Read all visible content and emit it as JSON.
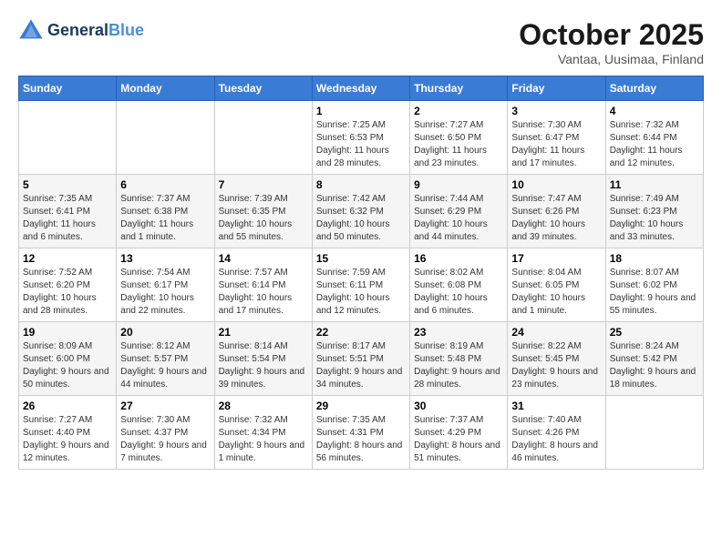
{
  "header": {
    "logo_line1": "General",
    "logo_line2": "Blue",
    "month": "October 2025",
    "location": "Vantaa, Uusimaa, Finland"
  },
  "weekdays": [
    "Sunday",
    "Monday",
    "Tuesday",
    "Wednesday",
    "Thursday",
    "Friday",
    "Saturday"
  ],
  "weeks": [
    [
      {
        "day": "",
        "info": ""
      },
      {
        "day": "",
        "info": ""
      },
      {
        "day": "",
        "info": ""
      },
      {
        "day": "1",
        "info": "Sunrise: 7:25 AM\nSunset: 6:53 PM\nDaylight: 11 hours and 28 minutes."
      },
      {
        "day": "2",
        "info": "Sunrise: 7:27 AM\nSunset: 6:50 PM\nDaylight: 11 hours and 23 minutes."
      },
      {
        "day": "3",
        "info": "Sunrise: 7:30 AM\nSunset: 6:47 PM\nDaylight: 11 hours and 17 minutes."
      },
      {
        "day": "4",
        "info": "Sunrise: 7:32 AM\nSunset: 6:44 PM\nDaylight: 11 hours and 12 minutes."
      }
    ],
    [
      {
        "day": "5",
        "info": "Sunrise: 7:35 AM\nSunset: 6:41 PM\nDaylight: 11 hours and 6 minutes."
      },
      {
        "day": "6",
        "info": "Sunrise: 7:37 AM\nSunset: 6:38 PM\nDaylight: 11 hours and 1 minute."
      },
      {
        "day": "7",
        "info": "Sunrise: 7:39 AM\nSunset: 6:35 PM\nDaylight: 10 hours and 55 minutes."
      },
      {
        "day": "8",
        "info": "Sunrise: 7:42 AM\nSunset: 6:32 PM\nDaylight: 10 hours and 50 minutes."
      },
      {
        "day": "9",
        "info": "Sunrise: 7:44 AM\nSunset: 6:29 PM\nDaylight: 10 hours and 44 minutes."
      },
      {
        "day": "10",
        "info": "Sunrise: 7:47 AM\nSunset: 6:26 PM\nDaylight: 10 hours and 39 minutes."
      },
      {
        "day": "11",
        "info": "Sunrise: 7:49 AM\nSunset: 6:23 PM\nDaylight: 10 hours and 33 minutes."
      }
    ],
    [
      {
        "day": "12",
        "info": "Sunrise: 7:52 AM\nSunset: 6:20 PM\nDaylight: 10 hours and 28 minutes."
      },
      {
        "day": "13",
        "info": "Sunrise: 7:54 AM\nSunset: 6:17 PM\nDaylight: 10 hours and 22 minutes."
      },
      {
        "day": "14",
        "info": "Sunrise: 7:57 AM\nSunset: 6:14 PM\nDaylight: 10 hours and 17 minutes."
      },
      {
        "day": "15",
        "info": "Sunrise: 7:59 AM\nSunset: 6:11 PM\nDaylight: 10 hours and 12 minutes."
      },
      {
        "day": "16",
        "info": "Sunrise: 8:02 AM\nSunset: 6:08 PM\nDaylight: 10 hours and 6 minutes."
      },
      {
        "day": "17",
        "info": "Sunrise: 8:04 AM\nSunset: 6:05 PM\nDaylight: 10 hours and 1 minute."
      },
      {
        "day": "18",
        "info": "Sunrise: 8:07 AM\nSunset: 6:02 PM\nDaylight: 9 hours and 55 minutes."
      }
    ],
    [
      {
        "day": "19",
        "info": "Sunrise: 8:09 AM\nSunset: 6:00 PM\nDaylight: 9 hours and 50 minutes."
      },
      {
        "day": "20",
        "info": "Sunrise: 8:12 AM\nSunset: 5:57 PM\nDaylight: 9 hours and 44 minutes."
      },
      {
        "day": "21",
        "info": "Sunrise: 8:14 AM\nSunset: 5:54 PM\nDaylight: 9 hours and 39 minutes."
      },
      {
        "day": "22",
        "info": "Sunrise: 8:17 AM\nSunset: 5:51 PM\nDaylight: 9 hours and 34 minutes."
      },
      {
        "day": "23",
        "info": "Sunrise: 8:19 AM\nSunset: 5:48 PM\nDaylight: 9 hours and 28 minutes."
      },
      {
        "day": "24",
        "info": "Sunrise: 8:22 AM\nSunset: 5:45 PM\nDaylight: 9 hours and 23 minutes."
      },
      {
        "day": "25",
        "info": "Sunrise: 8:24 AM\nSunset: 5:42 PM\nDaylight: 9 hours and 18 minutes."
      }
    ],
    [
      {
        "day": "26",
        "info": "Sunrise: 7:27 AM\nSunset: 4:40 PM\nDaylight: 9 hours and 12 minutes."
      },
      {
        "day": "27",
        "info": "Sunrise: 7:30 AM\nSunset: 4:37 PM\nDaylight: 9 hours and 7 minutes."
      },
      {
        "day": "28",
        "info": "Sunrise: 7:32 AM\nSunset: 4:34 PM\nDaylight: 9 hours and 1 minute."
      },
      {
        "day": "29",
        "info": "Sunrise: 7:35 AM\nSunset: 4:31 PM\nDaylight: 8 hours and 56 minutes."
      },
      {
        "day": "30",
        "info": "Sunrise: 7:37 AM\nSunset: 4:29 PM\nDaylight: 8 hours and 51 minutes."
      },
      {
        "day": "31",
        "info": "Sunrise: 7:40 AM\nSunset: 4:26 PM\nDaylight: 8 hours and 46 minutes."
      },
      {
        "day": "",
        "info": ""
      }
    ]
  ]
}
